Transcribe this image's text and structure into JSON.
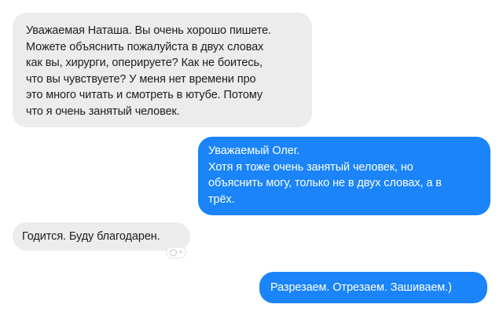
{
  "messages": [
    {
      "direction": "incoming",
      "lines": [
        "Уважаемая Наташа. Вы очень хорошо пишете.",
        "Можете объяснить пожалуйста в двух словах",
        "как вы, хирурги, оперируете? Как не боитесь,",
        "что вы чувствуете? У меня нет времени про",
        "это много читать и смотреть в ютубе. Потому",
        "что я очень занятый человек."
      ]
    },
    {
      "direction": "outgoing",
      "lines": [
        "Уважаемый Олег.",
        "Хотя я тоже очень занятый человек, но",
        "объяснить могу, только не в двух словах, а в",
        "трёх."
      ]
    },
    {
      "direction": "incoming",
      "lines": [
        "Годится. Буду благодарен."
      ]
    },
    {
      "direction": "outgoing",
      "lines": [
        "Разрезаем. Отрезаем. Зашиваем.)"
      ]
    }
  ],
  "reaction_icon": "add-reaction-icon",
  "colors": {
    "incoming_bubble": "#ececec",
    "outgoing_bubble": "#1a84f8",
    "incoming_text": "#1d1d1d",
    "outgoing_text": "#ffffff"
  }
}
